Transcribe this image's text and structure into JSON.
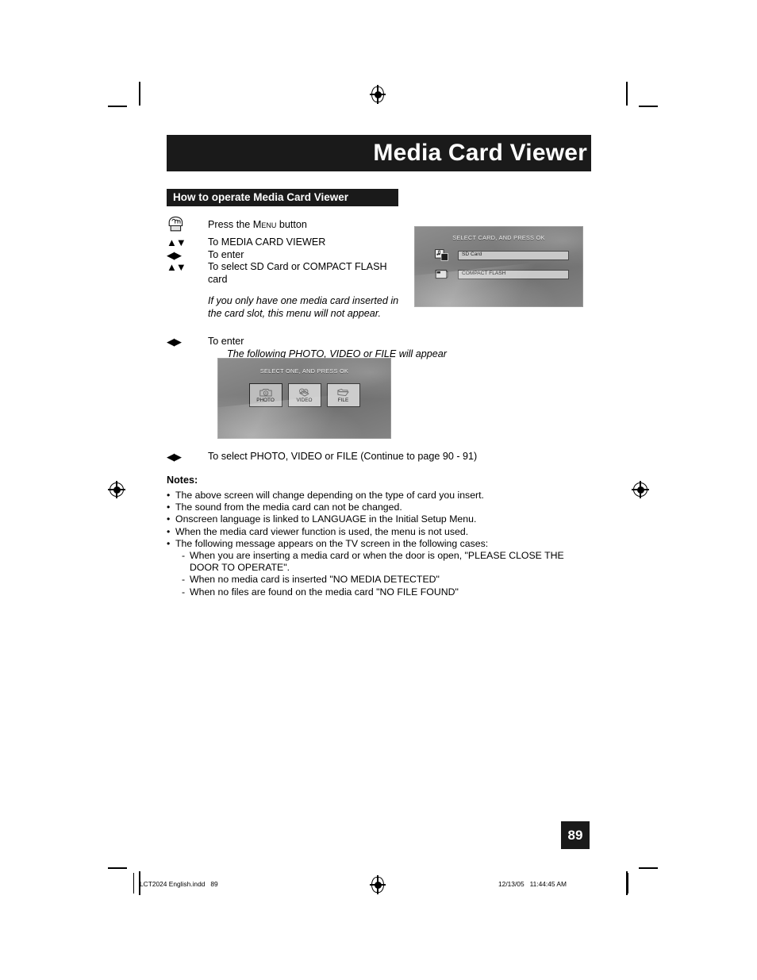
{
  "page": {
    "title": "Media Card Viewer",
    "section_heading": "How to operate Media Card Viewer",
    "page_number": "89"
  },
  "steps": [
    {
      "key_icon": "hand-press-icon",
      "key": "",
      "text_pre": "Press the ",
      "text_smallcaps": "Menu",
      "text_post": " button"
    },
    {
      "key": "▲▼",
      "text": "To MEDIA CARD VIEWER"
    },
    {
      "key": "◀▶",
      "text": "To enter"
    },
    {
      "key": "▲▼",
      "text": "To select SD Card or COMPACT FLASH card"
    }
  ],
  "italic_note_1": "If you only have one media card inserted in the card slot, this menu will not appear.",
  "enter_step": {
    "key": "◀▶",
    "text": "To enter",
    "sub_italic": "The following PHOTO, VIDEO or FILE will appear"
  },
  "select_step": {
    "key": "◀▶",
    "text": "To select PHOTO, VIDEO or FILE (Continue to page 90 - 91)"
  },
  "screen_card": {
    "heading": "SELECT CARD, AND PRESS OK",
    "items": [
      {
        "icon": "sd-card-icon",
        "label": "SD Card"
      },
      {
        "icon": "compact-flash-icon",
        "label": "COMPACT FLASH"
      }
    ]
  },
  "screen_mode": {
    "heading": "SELECT ONE, AND PRESS OK",
    "tiles": [
      {
        "icon": "camera-icon",
        "label": "PHOTO",
        "selected": true
      },
      {
        "icon": "film-icon",
        "label": "VIDEO",
        "selected": false
      },
      {
        "icon": "folder-icon",
        "label": "FILE",
        "selected": false
      }
    ]
  },
  "notes": {
    "title": "Notes:",
    "items": [
      "The above screen will change depending on the type of card you insert.",
      "The sound from the media card can not be changed.",
      "Onscreen language is linked to LANGUAGE in the Initial Setup Menu.",
      "When the media card viewer function is used, the menu is not used.",
      "The following message appears on the TV screen in the following cases:"
    ],
    "sub_items": [
      "When you are inserting a media card or when the door is open, \"PLEASE CLOSE THE DOOR TO OPERATE\".",
      "When no media card is inserted \"NO MEDIA DETECTED\"",
      "When no files are found on the media card \"NO FILE FOUND\""
    ]
  },
  "footer": {
    "left": "LCT2024 English.indd   89",
    "right": "12/13/05   11:44:45 AM"
  },
  "colors": {
    "ink": "#1a1a1a",
    "paper": "#ffffff",
    "screen_gray": "#7c7c7c"
  }
}
